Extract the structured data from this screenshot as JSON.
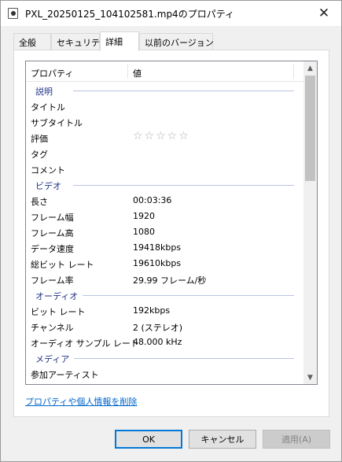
{
  "window": {
    "title": "PXL_20250125_104102581.mp4のプロパティ"
  },
  "tabs": [
    {
      "label": "全般"
    },
    {
      "label": "セキュリティ"
    },
    {
      "label": "詳細"
    },
    {
      "label": "以前のバージョン"
    }
  ],
  "active_tab": "詳細",
  "listview": {
    "columns": [
      "プロパティ",
      "値"
    ],
    "groups": {
      "description": "説明",
      "video": "ビデオ",
      "audio": "オーディオ",
      "media": "メディア"
    },
    "description_rows": [
      {
        "label": "タイトル",
        "value": ""
      },
      {
        "label": "サブタイトル",
        "value": ""
      },
      {
        "label": "評価",
        "value": ""
      },
      {
        "label": "タグ",
        "value": ""
      },
      {
        "label": "コメント",
        "value": ""
      }
    ],
    "rating_stars": "☆☆☆☆☆",
    "rating": 0,
    "video_rows": [
      {
        "label": "長さ",
        "value": "00:03:36"
      },
      {
        "label": "フレーム幅",
        "value": "1920"
      },
      {
        "label": "フレーム高",
        "value": "1080"
      },
      {
        "label": "データ速度",
        "value": "19418kbps"
      },
      {
        "label": "総ビット レート",
        "value": "19610kbps"
      },
      {
        "label": "フレーム率",
        "value": "29.99 フレーム/秒"
      }
    ],
    "audio_rows": [
      {
        "label": "ビット レート",
        "value": "192kbps"
      },
      {
        "label": "チャンネル",
        "value": "2 (ステレオ)"
      },
      {
        "label": "オーディオ サンプル レート",
        "value": "48.000 kHz"
      }
    ],
    "media_rows": [
      {
        "label": "参加アーティスト",
        "value": ""
      }
    ]
  },
  "remove_link": "プロパティや個人情報を削除",
  "buttons": {
    "ok": "OK",
    "cancel": "キャンセル",
    "apply": "適用(A)"
  },
  "icons": {
    "close": "close-icon",
    "scroll_up": "scroll-up-icon",
    "scroll_down": "scroll-down-icon"
  }
}
